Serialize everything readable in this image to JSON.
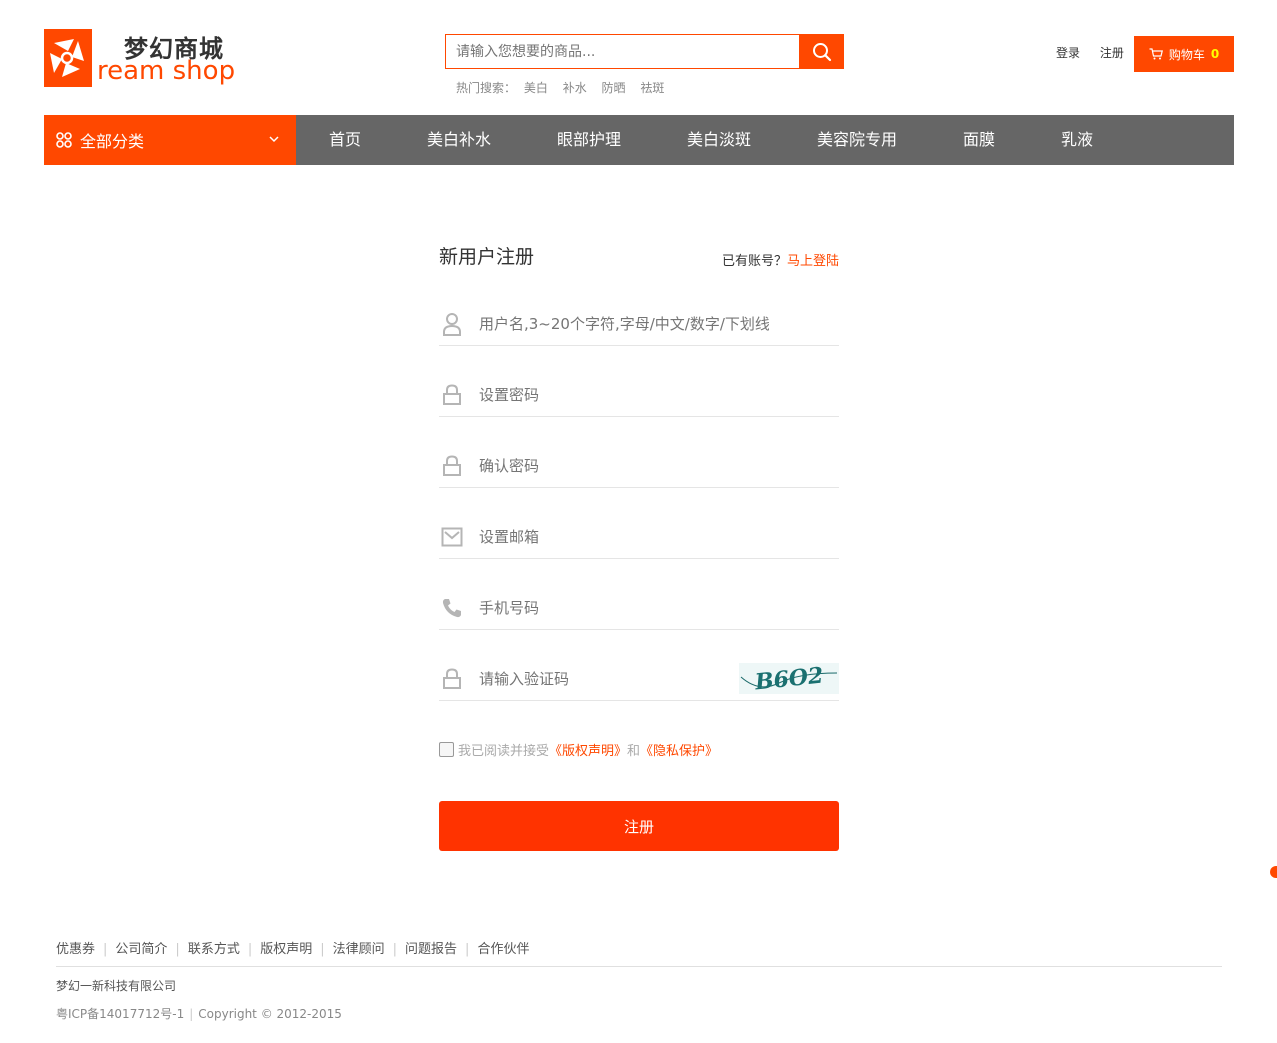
{
  "header": {
    "logo_cn": "梦幻商城",
    "logo_en": "ream shop",
    "search_placeholder": "请输入您想要的商品...",
    "hot_label": "热门搜索：",
    "hot_terms": [
      "美白",
      "补水",
      "防晒",
      "祛斑"
    ],
    "login": "登录",
    "register": "注册",
    "cart_label": "购物车",
    "cart_count": "0"
  },
  "nav": {
    "all_categories": "全部分类",
    "items": [
      "首页",
      "美白补水",
      "眼部护理",
      "美白淡斑",
      "美容院专用",
      "面膜",
      "乳液"
    ]
  },
  "form": {
    "title": "新用户注册",
    "have_account": "已有账号？",
    "login_now": "马上登陆",
    "username_placeholder": "用户名,3~20个字符,字母/中文/数字/下划线",
    "password_placeholder": "设置密码",
    "confirm_placeholder": "确认密码",
    "email_placeholder": "设置邮箱",
    "phone_placeholder": "手机号码",
    "captcha_placeholder": "请输入验证码",
    "captcha_text": "B6O2",
    "agree_text": "我已阅读并接受",
    "copyright_link": "《版权声明》",
    "and": "和",
    "privacy_link": "《隐私保护》",
    "submit": "注册"
  },
  "footer": {
    "links": [
      "优惠券",
      "公司简介",
      "联系方式",
      "版权声明",
      "法律顾问",
      "问题报告",
      "合作伙伴"
    ],
    "company": "梦幻一新科技有限公司",
    "icp": "粤ICP备14017712号-1",
    "copyright": "Copyright © 2012-2015"
  },
  "colors": {
    "brand": "#ff4800",
    "submit": "#ff3300",
    "nav_bg": "#666666"
  }
}
